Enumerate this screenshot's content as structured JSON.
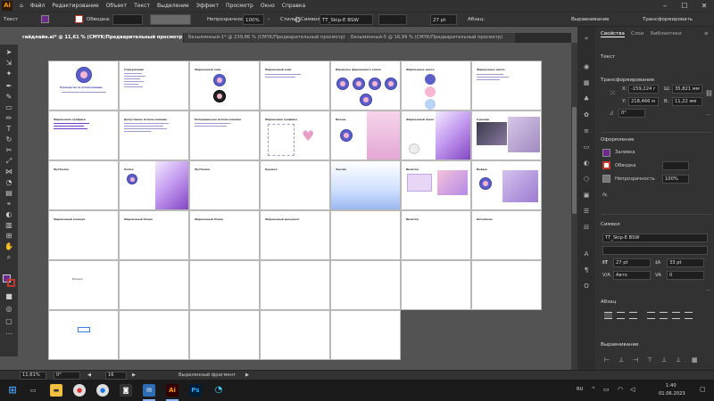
{
  "app": {
    "logo": "Ai",
    "brand_color": "#ff9a00"
  },
  "menu": [
    "Файл",
    "Редактирование",
    "Объект",
    "Текст",
    "Выделение",
    "Эффект",
    "Просмотр",
    "Окно",
    "Справка"
  ],
  "control_bar": {
    "selection_label": "Текст",
    "stroke_label": "Обводка:",
    "opacity_label": "Непрозрачность:",
    "opacity_value": "100%",
    "style_label": "Стиль:",
    "char_label": "Символ:",
    "font_name": "TT_Skip-E BSW",
    "font_size": "27 pt",
    "para_label": "Абзац:",
    "align_label": "Выравнивание",
    "transform_label": "Трансформировать"
  },
  "tabs": [
    {
      "label": "гайдлайн.ai* @ 11,61 % (CMYK/Предварительный просмотр)",
      "active": true
    },
    {
      "label": "Безымянный-1* @ 239,86 % (CMYK/Предварительный просмотр)",
      "active": false
    },
    {
      "label": "Безымянный-5 @ 16,99 % (CMYK/Предварительный просмотр)",
      "active": false
    }
  ],
  "artboards": {
    "row1": [
      "Руководство по использованию",
      "Содержание",
      "Фирменный знак",
      "Фирменный знак",
      "Варианты фирменного знака",
      "Фирменные цвета",
      "Фирменные цвета"
    ],
    "row2": [
      "Фирменная графика",
      "Допустимое использование",
      "Неправильное использование",
      "Фирменная графика",
      "Брошь",
      "Фирменный пакет",
      "Сувенир"
    ],
    "row3": [
      "Футболка",
      "Кепка",
      "Футболка",
      "Кружка",
      "Зонтик",
      "Визитка",
      "Бейдж"
    ],
    "row4": [
      "Фирменный конверт",
      "Фирменный бланк",
      "Фирменный бланк",
      "Фирменный документ",
      "",
      "Визитка",
      "Штемпель"
    ],
    "row5": [
      "",
      "",
      "",
      "",
      "",
      "",
      ""
    ],
    "misc_label": "Бланки"
  },
  "properties": {
    "tabs": [
      "Свойства",
      "Слои",
      "Библиотеки"
    ],
    "section_type": "Текст",
    "transform_title": "Трансформирование",
    "x_label": "X:",
    "x_value": "-159,224 г",
    "y_label": "Y:",
    "y_value": "218,466 м",
    "w_label": "Ш:",
    "w_value": "35,821 мм",
    "h_label": "В:",
    "h_value": "11,22 мм",
    "angle_value": "0°",
    "appearance_title": "Оформление",
    "fill_label": "Заливка",
    "stroke_label": "Обводка",
    "opacity_label": "Непрозрачность",
    "opacity_value": "100%",
    "fx_label": "fx.",
    "character_title": "Символ",
    "font_name": "TT_Skip-E BSW",
    "font_size": "27 pt",
    "leading": "33 pt",
    "tracking": "Авто",
    "kerning": "0",
    "paragraph_title": "Абзац",
    "align_title": "Выравнивание"
  },
  "status": {
    "zoom": "11,61%",
    "rotation": "0°",
    "artboard_num": "16",
    "tool_label": "Выделенный фрагмент"
  },
  "taskbar": {
    "lang": "RU",
    "time": "1:40",
    "date": "01.06.2023"
  },
  "colors": {
    "accent_purple": "#7e3fbf",
    "logo_blue": "#5b5fc7",
    "logo_pink": "#f7b6d2",
    "fill_swatch": "#6e2a8c",
    "stroke_swatch": "#c0392b"
  }
}
